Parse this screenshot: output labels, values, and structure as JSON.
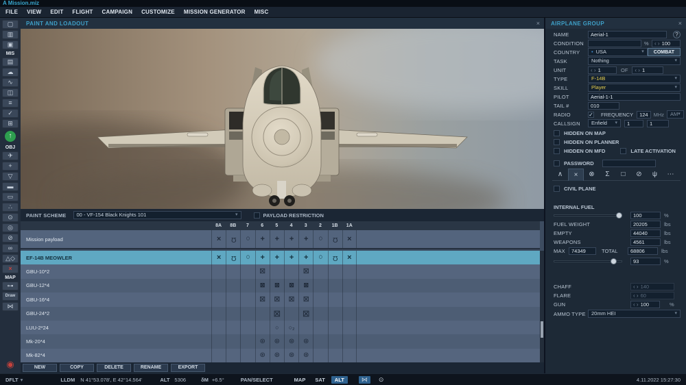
{
  "window": {
    "title": "A Mission.miz"
  },
  "menu": [
    "FILE",
    "VIEW",
    "EDIT",
    "FLIGHT",
    "CAMPAIGN",
    "CUSTOMIZE",
    "MISSION GENERATOR",
    "MISC"
  ],
  "sidebar": [
    {
      "t": "btn",
      "name": "new-mission",
      "g": "▢"
    },
    {
      "t": "btn",
      "name": "open-mission",
      "g": "▥"
    },
    {
      "t": "btn",
      "name": "save-mission",
      "g": "▣"
    },
    {
      "t": "label",
      "text": "MIS"
    },
    {
      "t": "btn",
      "name": "briefing",
      "g": "▤"
    },
    {
      "t": "btn",
      "name": "weather",
      "g": "☁"
    },
    {
      "t": "btn",
      "name": "route",
      "g": "∿"
    },
    {
      "t": "btn",
      "name": "module",
      "g": "◫"
    },
    {
      "t": "btn",
      "name": "list",
      "g": "≡"
    },
    {
      "t": "btn",
      "name": "check",
      "g": "✓"
    },
    {
      "t": "btn",
      "name": "groups",
      "g": "⊞"
    },
    {
      "t": "spawn",
      "name": "spawn",
      "g": "↑"
    },
    {
      "t": "label",
      "text": "OBJ"
    },
    {
      "t": "btn",
      "name": "airplane",
      "g": "✈"
    },
    {
      "t": "btn",
      "name": "helicopter",
      "g": "+"
    },
    {
      "t": "btn",
      "name": "ship",
      "g": "▽"
    },
    {
      "t": "btn",
      "name": "vehicle",
      "g": "▬"
    },
    {
      "t": "btn",
      "name": "static-object",
      "g": "▭"
    },
    {
      "t": "btn",
      "name": "column",
      "g": "∴"
    },
    {
      "t": "btn",
      "name": "rail",
      "g": "⊙"
    },
    {
      "t": "btn",
      "name": "target",
      "g": "◎"
    },
    {
      "t": "btn",
      "name": "zone",
      "g": "⊘"
    },
    {
      "t": "btn",
      "name": "chain",
      "g": "∞"
    },
    {
      "t": "btn",
      "name": "shapes",
      "g": "△◇"
    },
    {
      "t": "btn",
      "name": "delete",
      "g": "×",
      "red": true
    },
    {
      "t": "label",
      "text": "MAP"
    },
    {
      "t": "btn",
      "name": "key",
      "g": "⊶"
    },
    {
      "t": "btn",
      "name": "draw",
      "g": "Draw",
      "small": true
    },
    {
      "t": "btn",
      "name": "ruler",
      "g": "⋈"
    },
    {
      "t": "record",
      "name": "record",
      "g": "◉"
    }
  ],
  "paint_panel": {
    "title": "PAINT AND LOADOUT",
    "paint_scheme_label": "PAINT SCHEME",
    "paint_scheme_value": "00 - VF-154 Black Knights 101",
    "payload_restriction_label": "PAYLOAD RESTRICTION"
  },
  "payload_table": {
    "columns": [
      "8A",
      "8B",
      "7",
      "6",
      "5",
      "4",
      "3",
      "2",
      "1B",
      "1A"
    ],
    "icons": {
      "rail": "×",
      "missile": "Ω",
      "tank": "○",
      "pylon": "+",
      "gbu": "⊠",
      "gbu_sm": "⊠",
      "gbu_lg": "⊠",
      "flare": "○",
      "flare_x2": "○₂",
      "mk20": "⊛"
    },
    "mission_row": {
      "label": "Mission payload",
      "cells": [
        "rail",
        "missile",
        "tank",
        "pylon",
        "pylon",
        "pylon",
        "pylon",
        "tank",
        "missile",
        "rail"
      ]
    },
    "rows": [
      {
        "label": "EF-14B MEOWLER",
        "selected": true,
        "cells": [
          "rail",
          "missile",
          "tank",
          "pylon",
          "pylon",
          "pylon",
          "pylon",
          "tank",
          "missile",
          "rail"
        ]
      },
      {
        "label": "GBU-10*2",
        "cells": [
          "",
          "",
          "",
          "gbu",
          "",
          "",
          "gbu",
          "",
          "",
          ""
        ]
      },
      {
        "label": "GBU-12*4",
        "cells": [
          "",
          "",
          "",
          "gbu_sm",
          "gbu_sm",
          "gbu_sm",
          "gbu_sm",
          "",
          "",
          ""
        ]
      },
      {
        "label": "GBU-16*4",
        "cells": [
          "",
          "",
          "",
          "gbu",
          "gbu",
          "gbu",
          "gbu",
          "",
          "",
          ""
        ]
      },
      {
        "label": "GBU-24*2",
        "cells": [
          "",
          "",
          "",
          "",
          "gbu_lg",
          "",
          "gbu_lg",
          "",
          "",
          ""
        ]
      },
      {
        "label": "LUU-2*24",
        "cells": [
          "",
          "",
          "",
          "",
          "flare",
          "flare_x2",
          "",
          "",
          "",
          ""
        ]
      },
      {
        "label": "Mk-20*4",
        "cells": [
          "",
          "",
          "",
          "mk20",
          "mk20",
          "mk20",
          "mk20",
          "",
          "",
          ""
        ]
      },
      {
        "label": "Mk-82*4",
        "cells": [
          "",
          "",
          "",
          "mk20",
          "mk20",
          "mk20",
          "mk20",
          "",
          "",
          ""
        ]
      }
    ],
    "buttons": [
      "NEW",
      "COPY",
      "DELETE",
      "RENAME",
      "EXPORT"
    ]
  },
  "group_panel": {
    "title": "AIRPLANE GROUP",
    "tabs": [
      {
        "name": "tab-route",
        "g": "∧",
        "sel": false
      },
      {
        "name": "tab-payload",
        "g": "×",
        "sel": true
      },
      {
        "name": "tab-failures",
        "g": "⊗",
        "sel": false
      },
      {
        "name": "tab-summary",
        "g": "Σ",
        "sel": false
      },
      {
        "name": "tab-loadout-box",
        "g": "□",
        "sel": false
      },
      {
        "name": "tab-restrictions",
        "g": "⊘",
        "sel": false
      },
      {
        "name": "tab-radio",
        "g": "ψ",
        "sel": false
      },
      {
        "name": "tab-more",
        "g": "⋯",
        "sel": false
      }
    ],
    "fields": {
      "name_label": "NAME",
      "name_value": "Aerial-1",
      "help": "?",
      "condition_label": "CONDITION",
      "condition_value": "",
      "condition_unit": "%",
      "condition_spin": "100",
      "country_label": "COUNTRY",
      "country_value": "USA",
      "combat_label": "COMBAT",
      "task_label": "TASK",
      "task_value": "Nothing",
      "unit_label": "UNIT",
      "unit_count": "1",
      "of_label": "OF",
      "unit_of": "1",
      "type_label": "TYPE",
      "type_value": "F-14B",
      "skill_label": "SKILL",
      "skill_value": "Player",
      "pilot_label": "PILOT",
      "pilot_value": "Aerial-1-1",
      "tail_label": "TAIL #",
      "tail_value": "010",
      "radio_label": "RADIO",
      "frequency_label": "FREQUENCY",
      "frequency_value": "124",
      "frequency_unit": "MHz",
      "modulation": "AM",
      "callsign_label": "CALLSIGN",
      "callsign_value": "Enfield",
      "callsign_num1": "1",
      "callsign_num2": "1",
      "hidden_map": "HIDDEN ON MAP",
      "hidden_planner": "HIDDEN ON PLANNER",
      "hidden_mfd": "HIDDEN ON MFD",
      "late_activation": "LATE ACTIVATION",
      "password_label": "PASSWORD",
      "civil_label": "CIVIL PLANE",
      "internal_fuel_label": "INTERNAL FUEL",
      "internal_fuel_pct": "100",
      "pct_unit": "%",
      "fuel_weight_label": "FUEL WEIGHT",
      "fuel_weight": "20205",
      "empty_label": "EMPTY",
      "empty_value": "44040",
      "weapons_label": "WEAPONS",
      "weapons_value": "4561",
      "max_label": "MAX",
      "max_value": "74349",
      "total_label": "TOTAL",
      "total_value": "68806",
      "lbs_unit": "lbs",
      "fuel_slider2_pct": "93",
      "chaff_label": "CHAFF",
      "chaff_value": "140",
      "flare_label": "FLARE",
      "flare_value": "60",
      "gun_label": "GUN",
      "gun_value": "100",
      "ammo_label": "AMMO TYPE",
      "ammo_value": "20mm HEI"
    }
  },
  "bottombar": {
    "scale": "DFLT",
    "coords_sys": "LLDM",
    "coords": "N 41°53.078', E 42°14.564'",
    "alt_label": "ALT",
    "alt_value": "5306",
    "decl_label": "δM",
    "decl_value": "+6.5°",
    "mode": "PAN/SELECT",
    "layers": [
      "MAP",
      "SAT",
      "ALT"
    ],
    "active_layer": "ALT",
    "ruler_icon": "⋈",
    "clock_icon": "⊙",
    "datetime": "4.11.2022 15:27:30"
  },
  "colors": {
    "accent_cyan": "#3fa0c8",
    "selection": "#5fa8c2",
    "yellow": "#e7cf4f",
    "active_blue": "#2f628f"
  }
}
